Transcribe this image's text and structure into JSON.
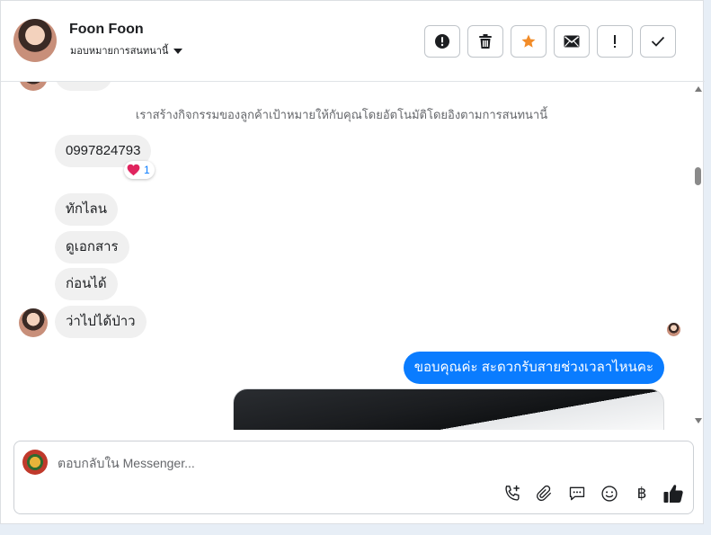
{
  "header": {
    "contact_name": "Foon Foon",
    "assign_label": "มอบหมายการสนทนานี้",
    "actions": [
      {
        "name": "report-button",
        "icon": "alert-circle-icon"
      },
      {
        "name": "delete-button",
        "icon": "trash-icon"
      },
      {
        "name": "star-button",
        "icon": "star-icon",
        "color": "#f28c28"
      },
      {
        "name": "mark-unread-button",
        "icon": "envelope-icon"
      },
      {
        "name": "follow-up-button",
        "icon": "exclamation-icon"
      },
      {
        "name": "mark-done-button",
        "icon": "check-icon"
      }
    ]
  },
  "conversation": {
    "system_message": "เราสร้างกิจกรรมของลูกค้าเป้าหมายให้กับคุณโดยอัตโนมัติโดยอิงตามการสนทนานี้",
    "messages": [
      {
        "direction": "in",
        "text": "0997824793",
        "reaction": {
          "emoji": "❤️",
          "count": "1"
        }
      },
      {
        "direction": "in",
        "text": "ทักไลน"
      },
      {
        "direction": "in",
        "text": "ดูเอกสาร"
      },
      {
        "direction": "in",
        "text": "ก่อนได้"
      },
      {
        "direction": "in",
        "text": "ว่าไปได้ป่าว"
      },
      {
        "direction": "out",
        "text": "ขอบคุณค่ะ สะดวกรับสายช่วงเวลาไหนคะ"
      }
    ]
  },
  "composer": {
    "placeholder": "ตอบกลับใน Messenger...",
    "value": "",
    "tools": [
      "phone-add-icon",
      "paperclip-icon",
      "chat-bubble-icon",
      "emoji-icon",
      "baht-icon",
      "thumbs-up-icon"
    ],
    "baht_symbol": "฿"
  },
  "colors": {
    "accent": "#0a7cff",
    "star": "#f28c28",
    "heart": "#e0245e"
  }
}
